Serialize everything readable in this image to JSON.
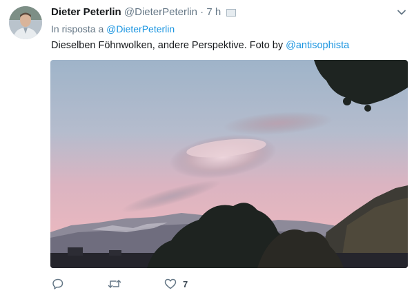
{
  "tweet": {
    "author_name": "Dieter Peterlin",
    "author_handle": "@DieterPeterlin",
    "separator": " · ",
    "time": "7 h",
    "reply_prefix": "In risposta a",
    "reply_handle": "@DieterPeterlin",
    "text_before": "Dieselben Föhnwolken, andere Perspektive. Foto by ",
    "mention": "@antisophista",
    "like_count": "7"
  },
  "icons": {
    "menu": "chevron-down-icon",
    "reply": "reply-icon",
    "retweet": "retweet-icon",
    "like": "heart-icon"
  },
  "colors": {
    "link": "#1b95e0",
    "secondary_text": "#657786",
    "sky_top": "#9fb4c9",
    "sky_pink": "#e9b6bf"
  }
}
